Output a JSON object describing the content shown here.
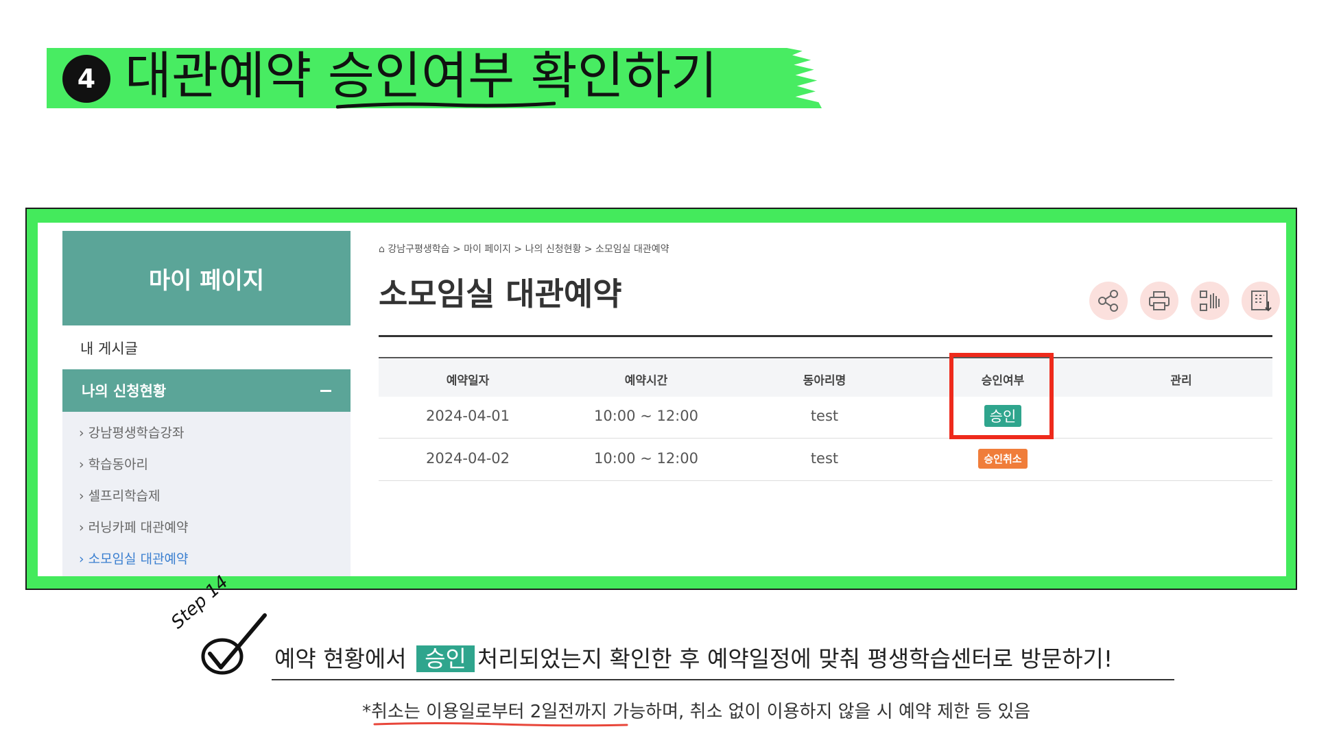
{
  "banner": {
    "step_number": "4",
    "title": "대관예약 승인여부 확인하기"
  },
  "sidebar": {
    "heading": "마이 페이지",
    "item_my_posts": "내 게시글",
    "active_section": "나의 신청현황",
    "sub_items": [
      {
        "label": "강남평생학습강좌",
        "current": false
      },
      {
        "label": "학습동아리",
        "current": false
      },
      {
        "label": "셀프리학습제",
        "current": false
      },
      {
        "label": "러닝카페 대관예약",
        "current": false
      },
      {
        "label": "소모임실 대관예약",
        "current": true
      }
    ]
  },
  "content": {
    "breadcrumb": "강남구평생학습 > 마이 페이지 > 나의 신청현황 > 소모임실 대관예약",
    "title": "소모임실 대관예약",
    "tools": [
      "share-icon",
      "print-icon",
      "qr-code-icon",
      "download-icon"
    ],
    "table": {
      "headers": [
        "예약일자",
        "예약시간",
        "동아리명",
        "승인여부",
        "관리"
      ],
      "rows": [
        {
          "date": "2024-04-01",
          "time": "10:00 ~ 12:00",
          "club": "test",
          "status": "승인",
          "manage": ""
        },
        {
          "date": "2024-04-02",
          "time": "10:00 ~ 12:00",
          "club": "test",
          "status": "승인취소",
          "manage": ""
        }
      ]
    },
    "highlight_color": "#ee2a1c"
  },
  "instruction": {
    "step_label": "Step 14",
    "text_before": "예약 현황에서",
    "badge": "승인",
    "text_after": "처리되었는지 확인한 후 예약일정에 맞춰 평생학습센터로 방문하기!",
    "note_underlined": "*취소는 이용일로부터 2일전까지",
    "note_rest": " 가능하며, 취소 없이 이용하지 않을 시 예약 제한 등 있음"
  },
  "colors": {
    "banner_green": "#48ec62",
    "teal": "#5ba598",
    "approve_badge": "#2fa58d",
    "cancel_badge": "#f07d3a",
    "tool_bg": "#fbe0dd"
  }
}
